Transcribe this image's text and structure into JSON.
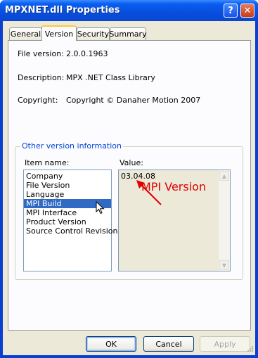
{
  "window": {
    "title": "MPXNET.dll Properties",
    "help_label": "?",
    "close_label": "✕"
  },
  "tabs": [
    {
      "label": "General",
      "active": false
    },
    {
      "label": "Version",
      "active": true
    },
    {
      "label": "Security",
      "active": false
    },
    {
      "label": "Summary",
      "active": false
    }
  ],
  "fields": {
    "file_version_label": "File version:",
    "file_version_value": "2.0.0.1963",
    "description_label": "Description:",
    "description_value": "MPX .NET Class Library",
    "copyright_label": "Copyright:",
    "copyright_value": "Copyright © Danaher Motion 2007"
  },
  "other_info": {
    "legend": "Other version information",
    "item_name_label": "Item name:",
    "value_label": "Value:",
    "items": [
      "Company",
      "File Version",
      "Language",
      "MPI Build",
      "MPI Interface",
      "Product Version",
      "Source Control Revision"
    ],
    "selected_index": 3,
    "value": "03.04.08"
  },
  "annotation": {
    "text": "MPI Version",
    "color": "#e00000"
  },
  "buttons": {
    "ok": "OK",
    "cancel": "Cancel",
    "apply": "Apply"
  },
  "colors": {
    "title_bar": "#0a5ef0",
    "selection": "#316ac5",
    "legend_text": "#0046d5"
  }
}
